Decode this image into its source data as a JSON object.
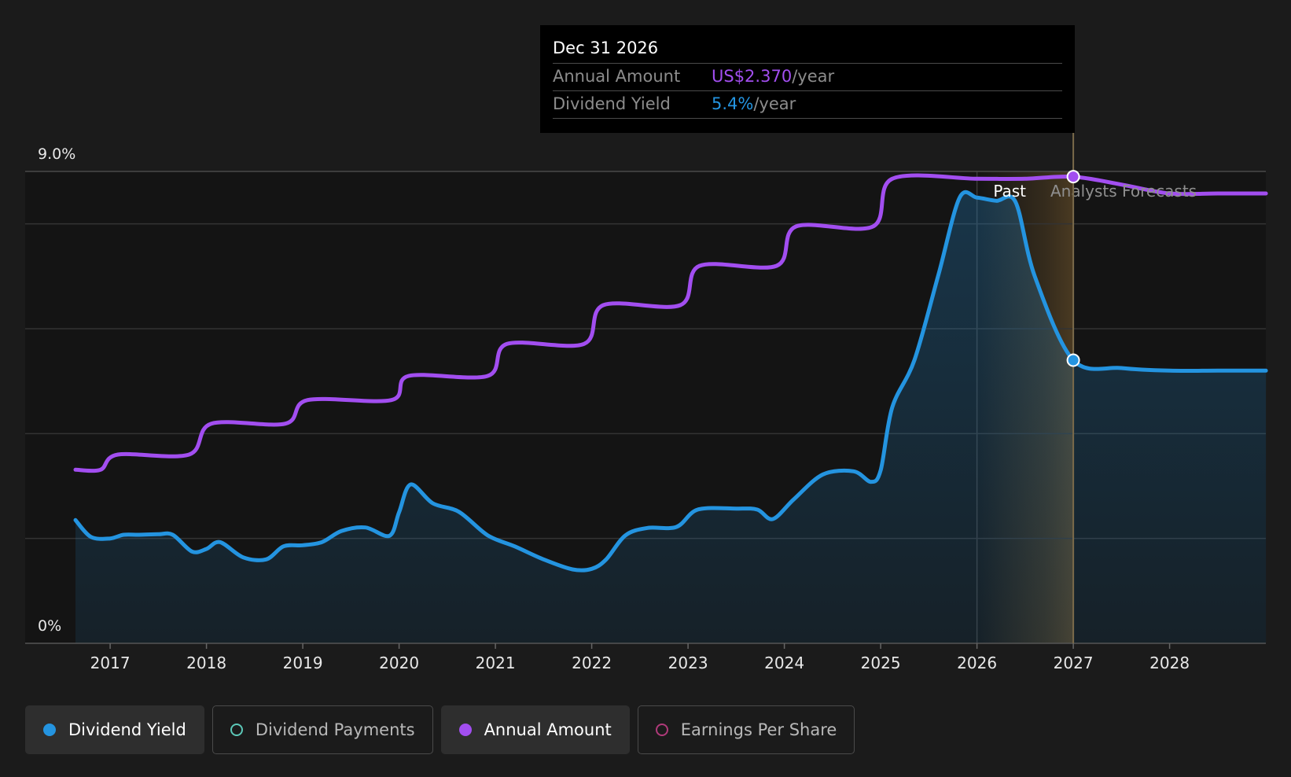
{
  "colors": {
    "yield": "#2494e0",
    "annual": "#a24ef0",
    "payments": "#5cc8b8",
    "eps": "#b03a7a",
    "background": "#1b1b1b",
    "plot_background": "#141414",
    "forecast_band": "#3a2f1e"
  },
  "tooltip": {
    "date": "Dec 31 2026",
    "rows": [
      {
        "label": "Annual Amount",
        "value": "US$2.370",
        "unit": "/year"
      },
      {
        "label": "Dividend Yield",
        "value": "5.4%",
        "unit": "/year"
      }
    ]
  },
  "annotations": {
    "past": "Past",
    "forecast": "Analysts Forecasts"
  },
  "legend": [
    {
      "label": "Dividend Yield",
      "color": "#2494e0",
      "filled": true,
      "active": true
    },
    {
      "label": "Dividend Payments",
      "color": "#5cc8b8",
      "filled": false,
      "active": false
    },
    {
      "label": "Annual Amount",
      "color": "#a24ef0",
      "filled": true,
      "active": true
    },
    {
      "label": "Earnings Per Share",
      "color": "#b03a7a",
      "filled": false,
      "active": false
    }
  ],
  "chart_data": {
    "type": "line",
    "x_axis": {
      "ticks": [
        "2017",
        "2018",
        "2019",
        "2020",
        "2021",
        "2022",
        "2023",
        "2024",
        "2025",
        "2026",
        "2027",
        "2028"
      ],
      "range": [
        2016.5,
        2029.0
      ]
    },
    "y_axis": {
      "tick_labels": [
        "9.0%",
        "0%"
      ],
      "range": [
        0,
        9.0
      ],
      "unit": "%"
    },
    "grid": true,
    "forecast_start": 2026.0,
    "highlight_x": 2027.0,
    "series": [
      {
        "name": "Dividend Yield",
        "color": "#2494e0",
        "area": true,
        "points": [
          [
            2016.64,
            2.35
          ],
          [
            2016.8,
            2.03
          ],
          [
            2017.0,
            2.0
          ],
          [
            2017.14,
            2.07
          ],
          [
            2017.3,
            2.07
          ],
          [
            2017.5,
            2.08
          ],
          [
            2017.65,
            2.07
          ],
          [
            2017.85,
            1.75
          ],
          [
            2018.0,
            1.8
          ],
          [
            2018.14,
            1.93
          ],
          [
            2018.38,
            1.64
          ],
          [
            2018.62,
            1.6
          ],
          [
            2018.8,
            1.85
          ],
          [
            2019.0,
            1.87
          ],
          [
            2019.2,
            1.93
          ],
          [
            2019.4,
            2.14
          ],
          [
            2019.65,
            2.21
          ],
          [
            2019.9,
            2.05
          ],
          [
            2020.0,
            2.5
          ],
          [
            2020.12,
            3.03
          ],
          [
            2020.35,
            2.67
          ],
          [
            2020.62,
            2.51
          ],
          [
            2020.92,
            2.06
          ],
          [
            2021.2,
            1.85
          ],
          [
            2021.5,
            1.6
          ],
          [
            2021.8,
            1.41
          ],
          [
            2022.0,
            1.42
          ],
          [
            2022.15,
            1.6
          ],
          [
            2022.35,
            2.06
          ],
          [
            2022.58,
            2.2
          ],
          [
            2022.88,
            2.22
          ],
          [
            2023.1,
            2.55
          ],
          [
            2023.5,
            2.57
          ],
          [
            2023.72,
            2.55
          ],
          [
            2023.88,
            2.37
          ],
          [
            2024.1,
            2.75
          ],
          [
            2024.4,
            3.22
          ],
          [
            2024.72,
            3.28
          ],
          [
            2024.9,
            3.08
          ],
          [
            2025.0,
            3.3
          ],
          [
            2025.12,
            4.5
          ],
          [
            2025.35,
            5.4
          ],
          [
            2025.6,
            7.03
          ],
          [
            2025.82,
            8.5
          ],
          [
            2026.0,
            8.5
          ],
          [
            2026.2,
            8.44
          ],
          [
            2026.4,
            8.42
          ],
          [
            2026.6,
            7.0
          ],
          [
            2027.0,
            5.4
          ],
          [
            2027.5,
            5.25
          ],
          [
            2028.0,
            5.2
          ],
          [
            2028.5,
            5.2
          ],
          [
            2029.0,
            5.2
          ]
        ]
      },
      {
        "name": "Annual Amount",
        "color": "#a24ef0",
        "area": false,
        "points": [
          [
            2016.64,
            3.31
          ],
          [
            2016.9,
            3.31
          ],
          [
            2017.08,
            3.6
          ],
          [
            2017.82,
            3.6
          ],
          [
            2018.05,
            4.19
          ],
          [
            2018.82,
            4.19
          ],
          [
            2019.05,
            4.64
          ],
          [
            2019.92,
            4.64
          ],
          [
            2020.1,
            5.1
          ],
          [
            2020.92,
            5.1
          ],
          [
            2021.12,
            5.71
          ],
          [
            2021.92,
            5.71
          ],
          [
            2022.12,
            6.45
          ],
          [
            2022.92,
            6.45
          ],
          [
            2023.12,
            7.2
          ],
          [
            2023.92,
            7.2
          ],
          [
            2024.12,
            7.95
          ],
          [
            2024.92,
            7.95
          ],
          [
            2025.12,
            8.86
          ],
          [
            2026.0,
            8.86
          ],
          [
            2026.5,
            8.86
          ],
          [
            2027.0,
            8.9
          ],
          [
            2027.5,
            8.75
          ],
          [
            2028.0,
            8.58
          ],
          [
            2028.5,
            8.58
          ],
          [
            2029.0,
            8.58
          ]
        ]
      }
    ],
    "markers": [
      {
        "series": "Annual Amount",
        "x": 2027.0,
        "y": 8.9
      },
      {
        "series": "Dividend Yield",
        "x": 2027.0,
        "y": 5.4
      }
    ]
  }
}
